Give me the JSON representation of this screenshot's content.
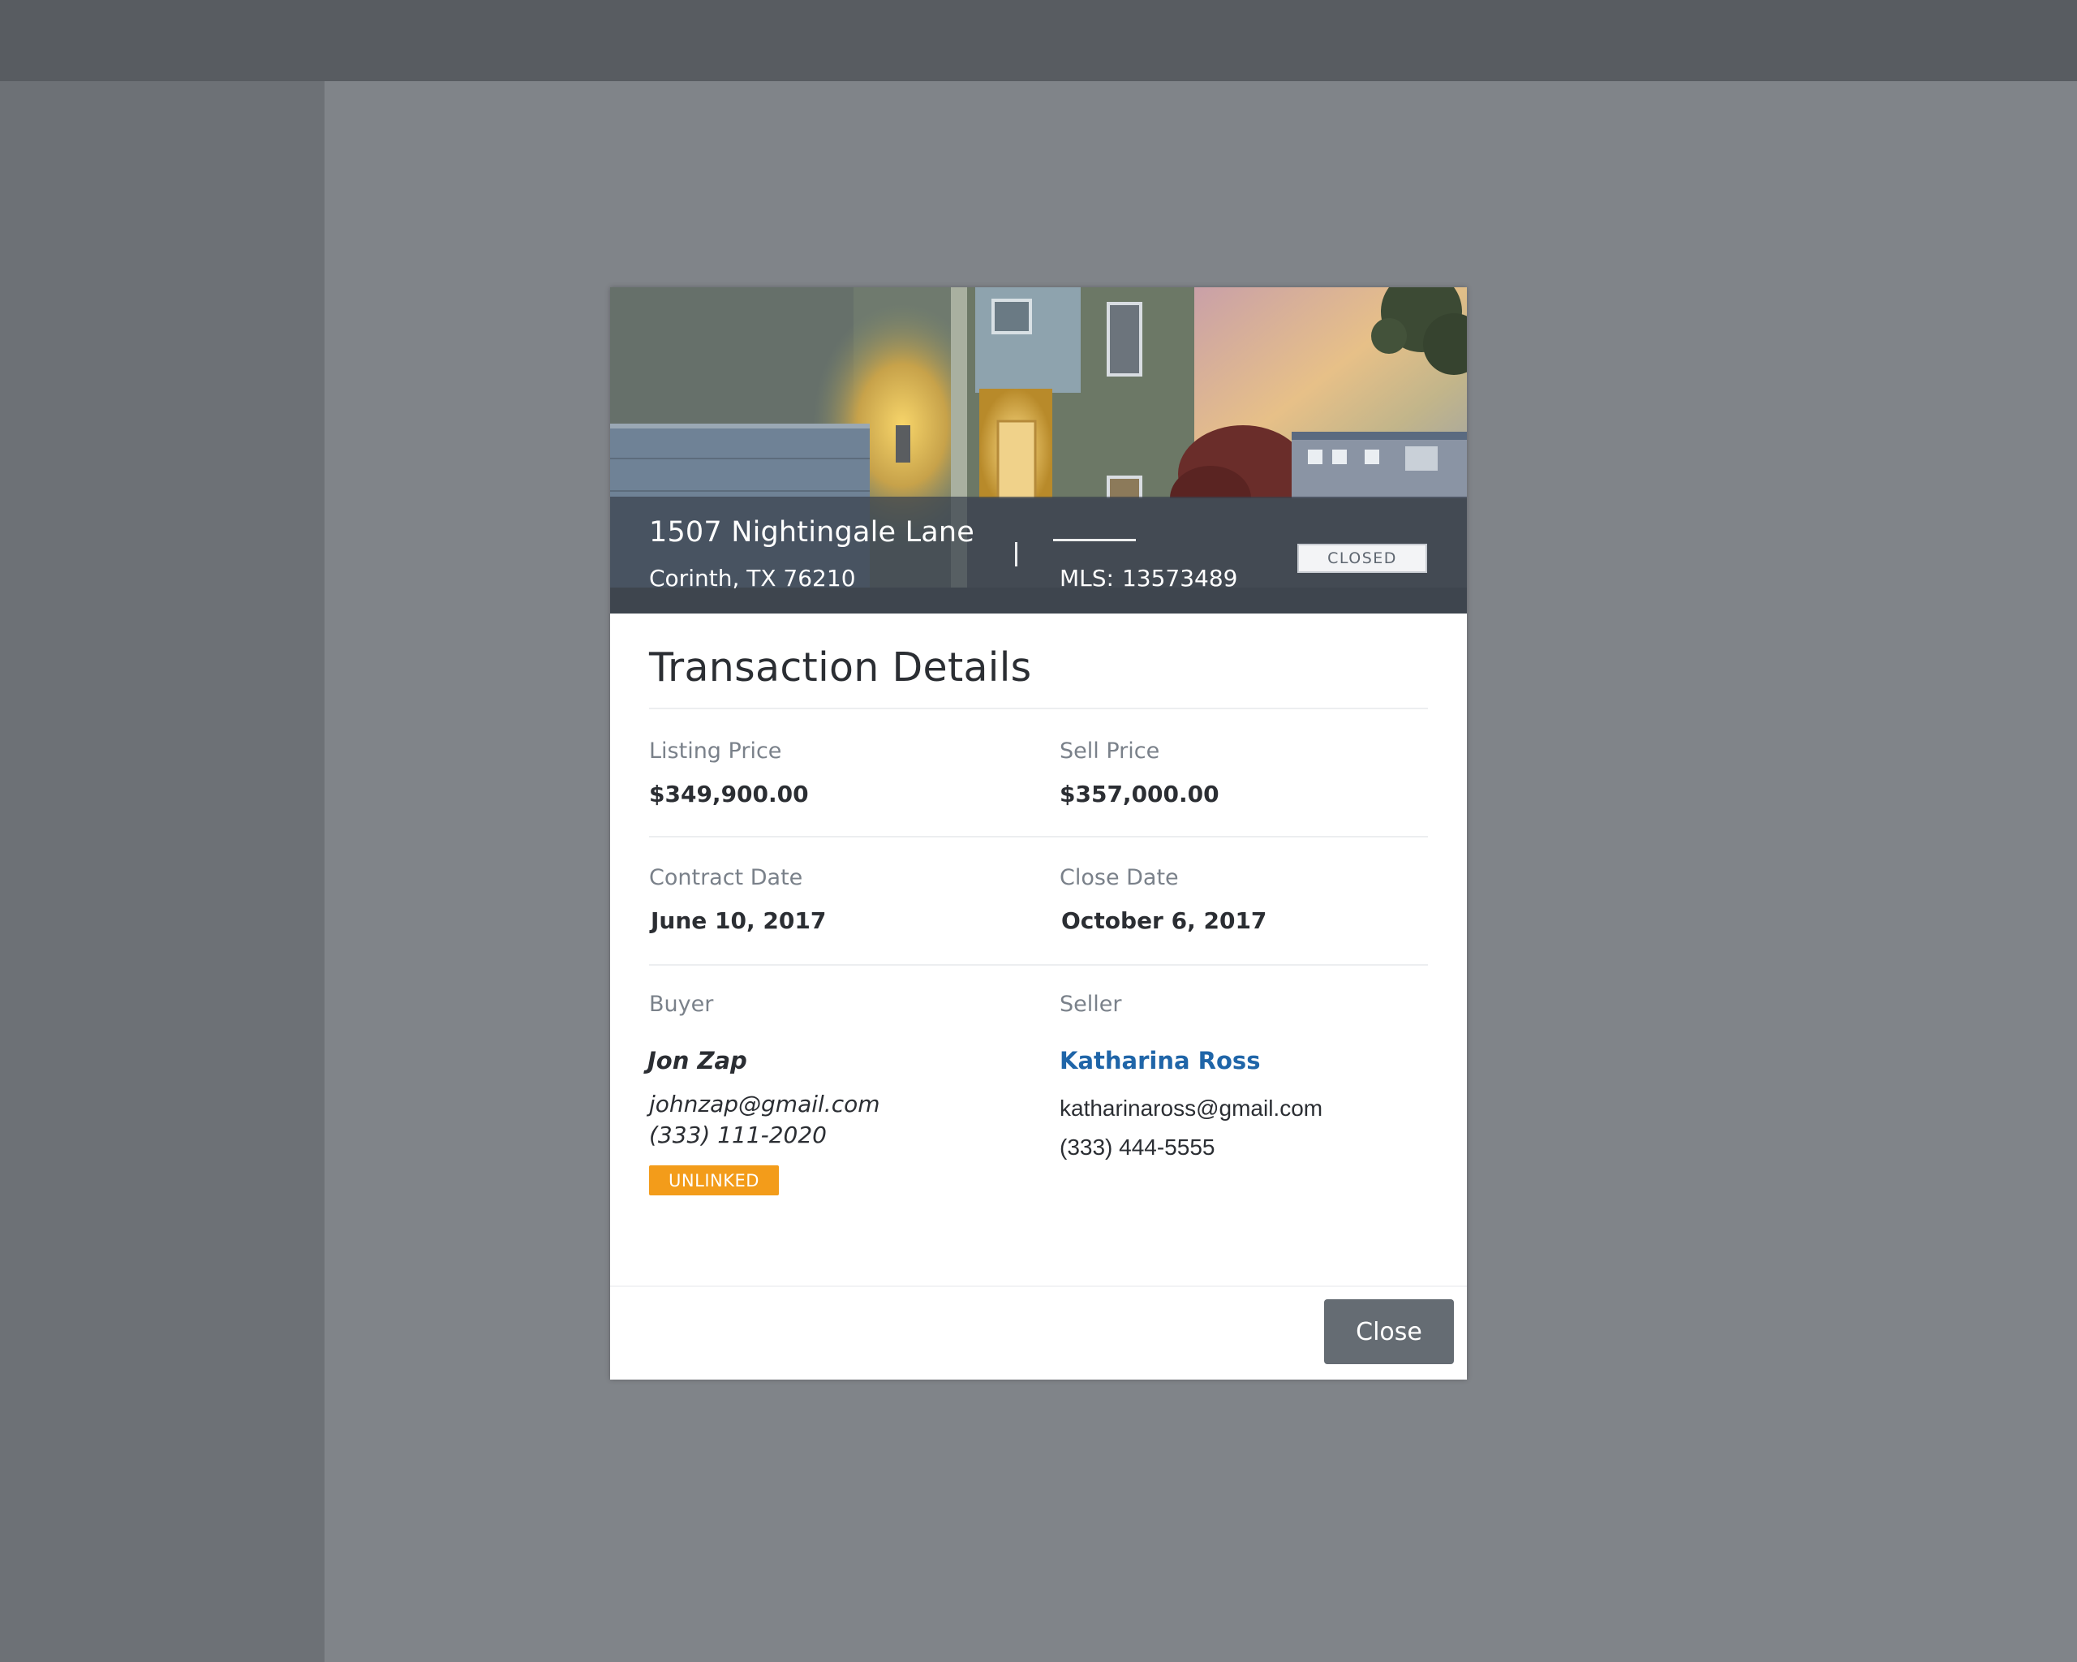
{
  "property": {
    "street": "1507 Nightingale Lane",
    "city_state_zip": "Corinth, TX 76210",
    "mls_label": "MLS:",
    "mls_number": "13573489",
    "status": "CLOSED"
  },
  "details": {
    "title": "Transaction Details",
    "listing_price_label": "Listing Price",
    "listing_price": "$349,900.00",
    "sell_price_label": "Sell Price",
    "sell_price": "$357,000.00",
    "contract_date_label": "Contract Date",
    "contract_date": "June 10, 2017",
    "close_date_label": "Close Date",
    "close_date": "October 6, 2017",
    "buyer_label": "Buyer",
    "buyer": {
      "name": "Jon Zap",
      "email": "johnzap@gmail.com",
      "phone": "(333) 111-2020",
      "badge": "UNLINKED"
    },
    "seller_label": "Seller",
    "seller": {
      "name": "Katharina Ross",
      "email": "katharinaross@gmail.com",
      "phone": "(333) 444-5555"
    }
  },
  "footer": {
    "close_label": "Close"
  },
  "colors": {
    "overlay": "#80848a",
    "link": "#1f65a8",
    "badge_unlinked": "#f39c1a",
    "button": "#656c73"
  },
  "icons": {
    "hero": "house-photo"
  }
}
